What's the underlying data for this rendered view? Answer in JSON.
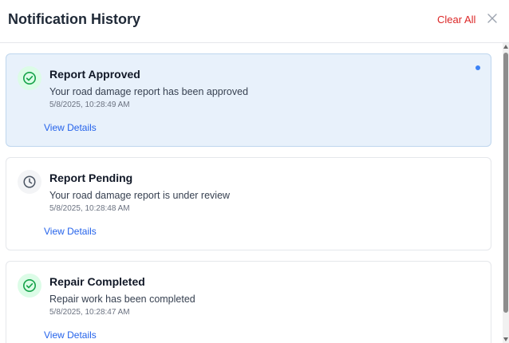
{
  "header": {
    "title": "Notification History",
    "clear_all_label": "Clear All",
    "close_icon": "close-icon"
  },
  "colors": {
    "accent": "#2563eb",
    "danger": "#dc2626",
    "success": "#16a34a",
    "unread_bg": "#e8f1fb"
  },
  "notifications": [
    {
      "title": "Report Approved",
      "message": "Your road damage report has been approved",
      "timestamp": "5/8/2025, 10:28:49 AM",
      "link_label": "View Details",
      "icon": "check-circle-icon",
      "unread": true
    },
    {
      "title": "Report Pending",
      "message": "Your road damage report is under review",
      "timestamp": "5/8/2025, 10:28:48 AM",
      "link_label": "View Details",
      "icon": "clock-icon",
      "unread": false
    },
    {
      "title": "Repair Completed",
      "message": "Repair work has been completed",
      "timestamp": "5/8/2025, 10:28:47 AM",
      "link_label": "View Details",
      "icon": "check-circle-icon",
      "unread": false
    }
  ]
}
